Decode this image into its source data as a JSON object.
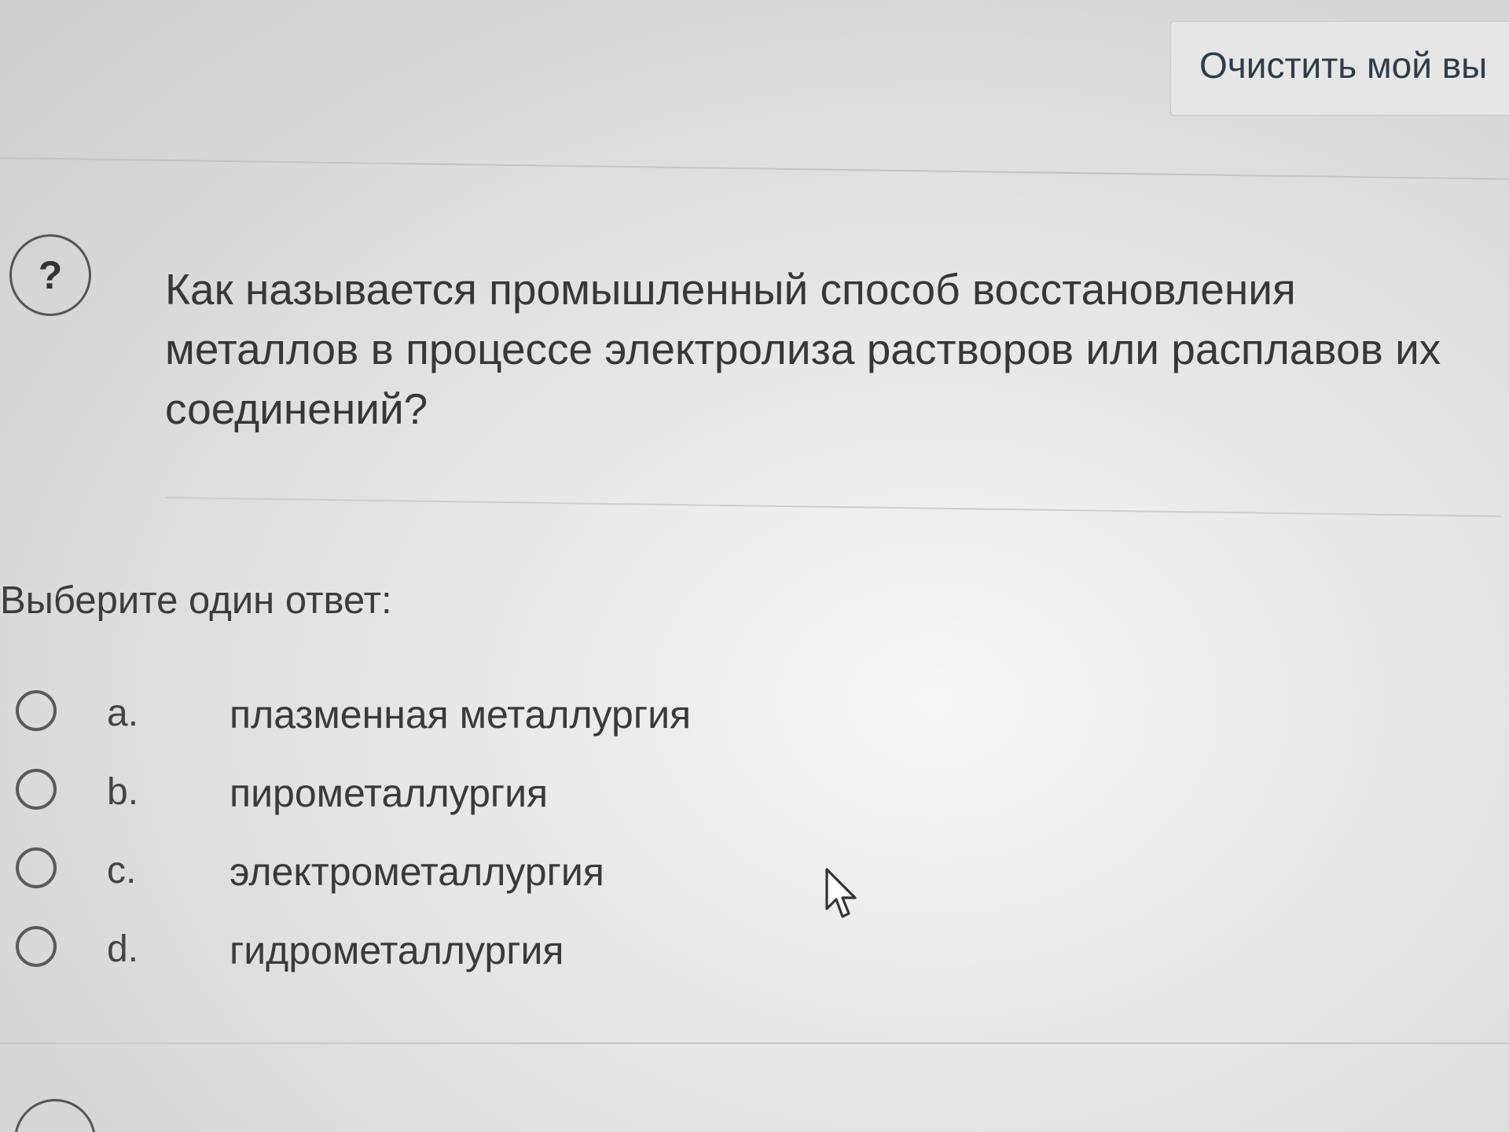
{
  "header": {
    "clear_button_label": "Очистить мой вы"
  },
  "question": {
    "icon_glyph": "?",
    "text": "Как называется промышленный способ восстановления металлов в процессе электролиза растворов или расплавов их соединений?"
  },
  "answer": {
    "prompt": "Выберите один ответ:",
    "options": [
      {
        "letter": "a.",
        "label": "плазменная металлургия"
      },
      {
        "letter": "b.",
        "label": "пирометаллургия"
      },
      {
        "letter": "c.",
        "label": "электрометаллургия"
      },
      {
        "letter": "d.",
        "label": "гидрометаллургия"
      }
    ]
  },
  "icons": {
    "question": "question-mark-icon",
    "cursor": "mouse-pointer-icon"
  }
}
